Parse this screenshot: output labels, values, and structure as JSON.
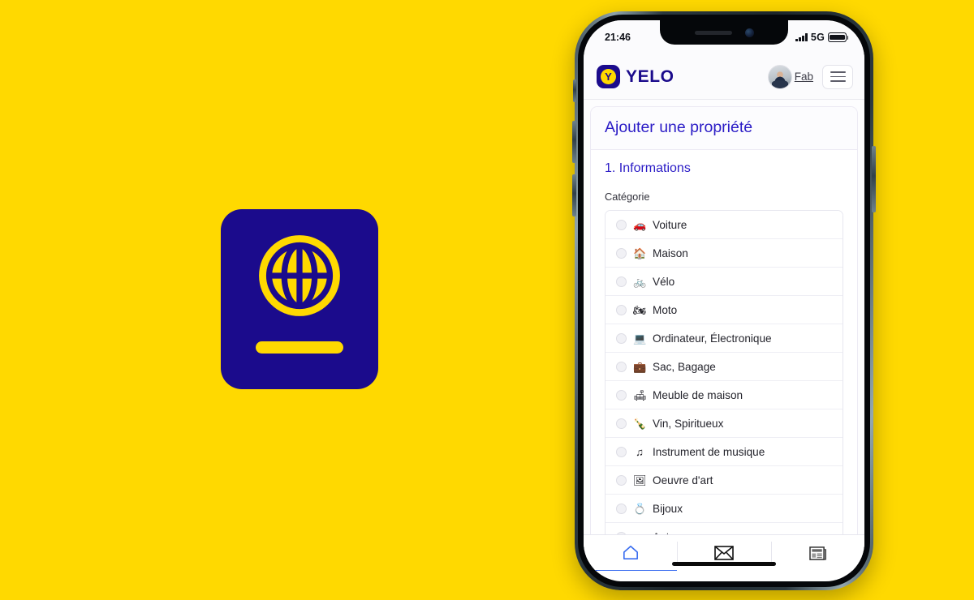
{
  "background_color": "#FFD900",
  "brand_colors": {
    "yellow": "#FFD900",
    "navy": "#1B0B8C",
    "indigo": "#2B1CC6",
    "accent_blue": "#3b6ef0"
  },
  "passport_logo": {
    "icon": "passport-globe-icon",
    "alt": "passport"
  },
  "phone": {
    "status_bar": {
      "time": "21:46",
      "network": "5G",
      "signal_icon": "cellular-signal-icon",
      "battery_icon": "battery-full-icon"
    },
    "notch": {
      "speaker_icon": "earpiece-speaker",
      "camera_icon": "front-camera"
    }
  },
  "header": {
    "brand_mark_letter": "Y",
    "brand_text": "YELO",
    "user_name": "Fab",
    "avatar_icon": "user-avatar",
    "menu_icon": "hamburger-menu-icon"
  },
  "page": {
    "title": "Ajouter une propriété",
    "section_title": "1. Informations",
    "field_label": "Catégorie",
    "categories": [
      {
        "icon": "car-icon",
        "glyph": "🚗",
        "label": "Voiture",
        "selected": false
      },
      {
        "icon": "house-icon",
        "glyph": "🏠",
        "label": "Maison",
        "selected": false
      },
      {
        "icon": "bicycle-icon",
        "glyph": "🚲",
        "label": "Vélo",
        "selected": false
      },
      {
        "icon": "motorcycle-icon",
        "glyph": "🏍",
        "label": "Moto",
        "selected": false
      },
      {
        "icon": "laptop-icon",
        "glyph": "💻",
        "label": "Ordinateur, Électronique",
        "selected": false
      },
      {
        "icon": "suitcase-icon",
        "glyph": "💼",
        "label": "Sac, Bagage",
        "selected": false
      },
      {
        "icon": "couch-icon",
        "glyph": "🛋",
        "label": "Meuble de maison",
        "selected": false
      },
      {
        "icon": "wine-bottle-icon",
        "glyph": "🍾",
        "label": "Vin, Spiritueux",
        "selected": false
      },
      {
        "icon": "music-note-icon",
        "glyph": "♫",
        "label": "Instrument de musique",
        "selected": false
      },
      {
        "icon": "artwork-icon",
        "glyph": "🖼",
        "label": "Oeuvre d'art",
        "selected": false
      },
      {
        "icon": "jewelry-icon",
        "glyph": "💍",
        "label": "Bijoux",
        "selected": false
      },
      {
        "icon": "",
        "glyph": "",
        "label": "Autre",
        "selected": false
      }
    ]
  },
  "tabbar": {
    "items": [
      {
        "icon": "home-icon",
        "label": "",
        "active": true
      },
      {
        "icon": "envelope-icon",
        "label": "",
        "active": false
      },
      {
        "icon": "newspaper-icon",
        "label": "",
        "active": false
      }
    ]
  }
}
